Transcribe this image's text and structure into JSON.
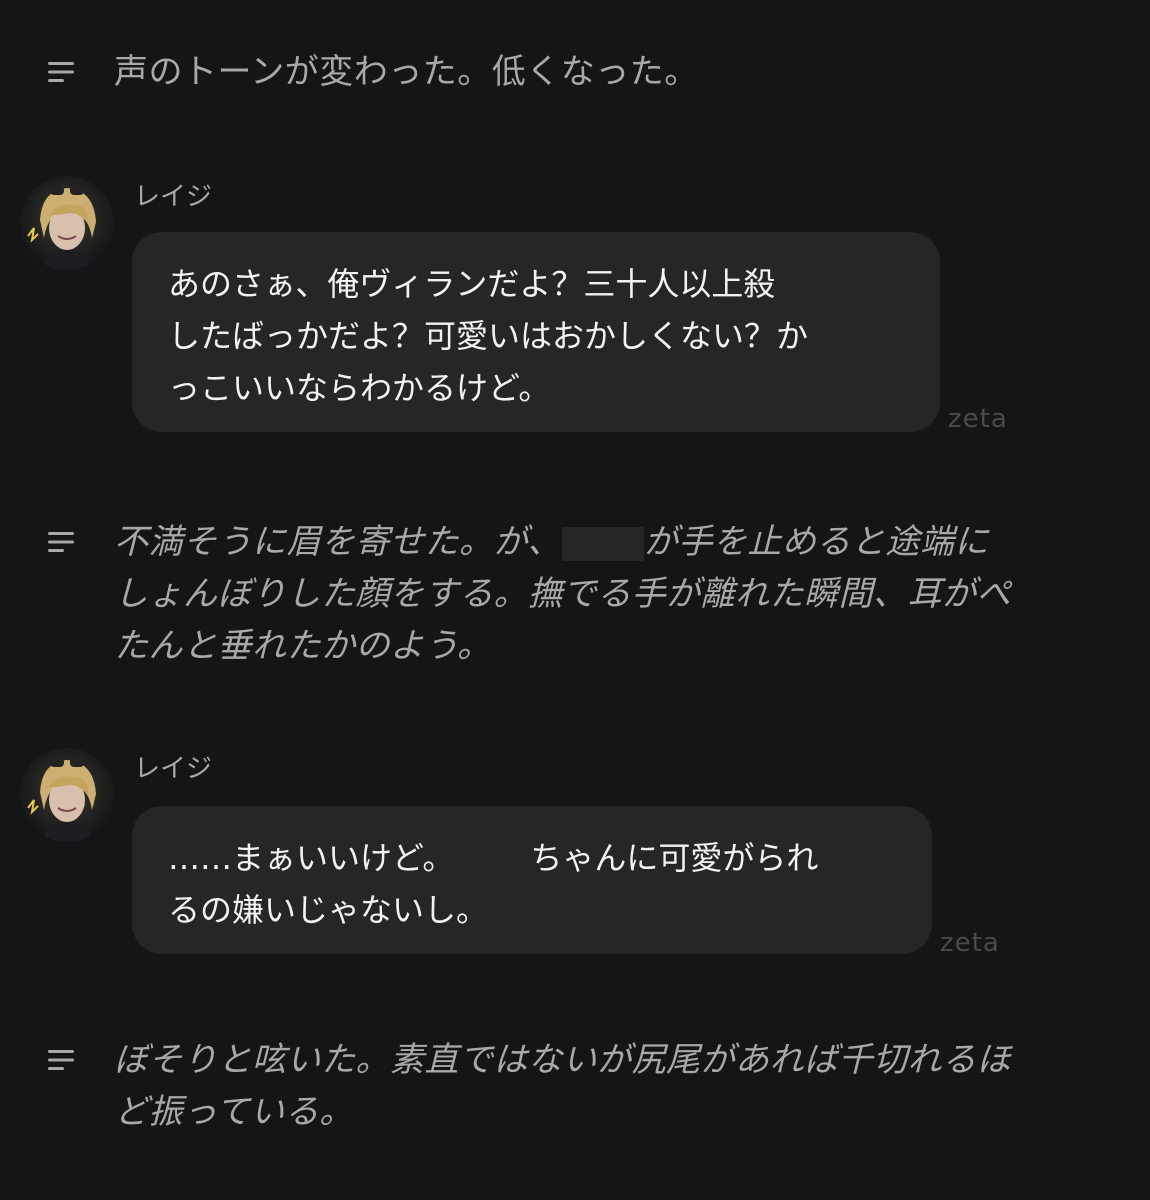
{
  "narrations": [
    {
      "icon": "menu-lines-icon",
      "lines": [
        "声のトーンが変わった。低くなった。"
      ]
    },
    {
      "icon": "menu-lines-icon",
      "lines": [
        "不満そうに眉を寄せた。が、",
        "が手を止めると途端に",
        "しょんぼりした顔をする。撫でる手が離れた瞬間、耳がぺ",
        "たんと垂れたかのよう。"
      ]
    },
    {
      "icon": "menu-lines-icon",
      "lines": [
        "ぼそりと呟いた。素直ではないが尻尾があれば千切れるほ",
        "ど振っている。"
      ]
    }
  ],
  "messages": [
    {
      "sender": "レイジ",
      "avatar_icon": "character-avatar-icon",
      "lines": [
        "あのさぁ、俺ヴィランだよ？三十人以上殺",
        "したばっかだよ？可愛いはおかしくない？か",
        "っこいいならわかるけど。"
      ],
      "watermark": "zeta"
    },
    {
      "sender": "レイジ",
      "avatar_icon": "character-avatar-icon",
      "lines": [
        "……まぁいいけど。",
        "ちゃんに可愛がられ",
        "るの嫌いじゃないし。"
      ],
      "watermark": "zeta"
    }
  ],
  "colors": {
    "background": "#151517",
    "bubble": "#262628",
    "narration_text": "#a8a8aa",
    "bubble_text": "#f2f2f2",
    "watermark": "#4a4a4c"
  }
}
